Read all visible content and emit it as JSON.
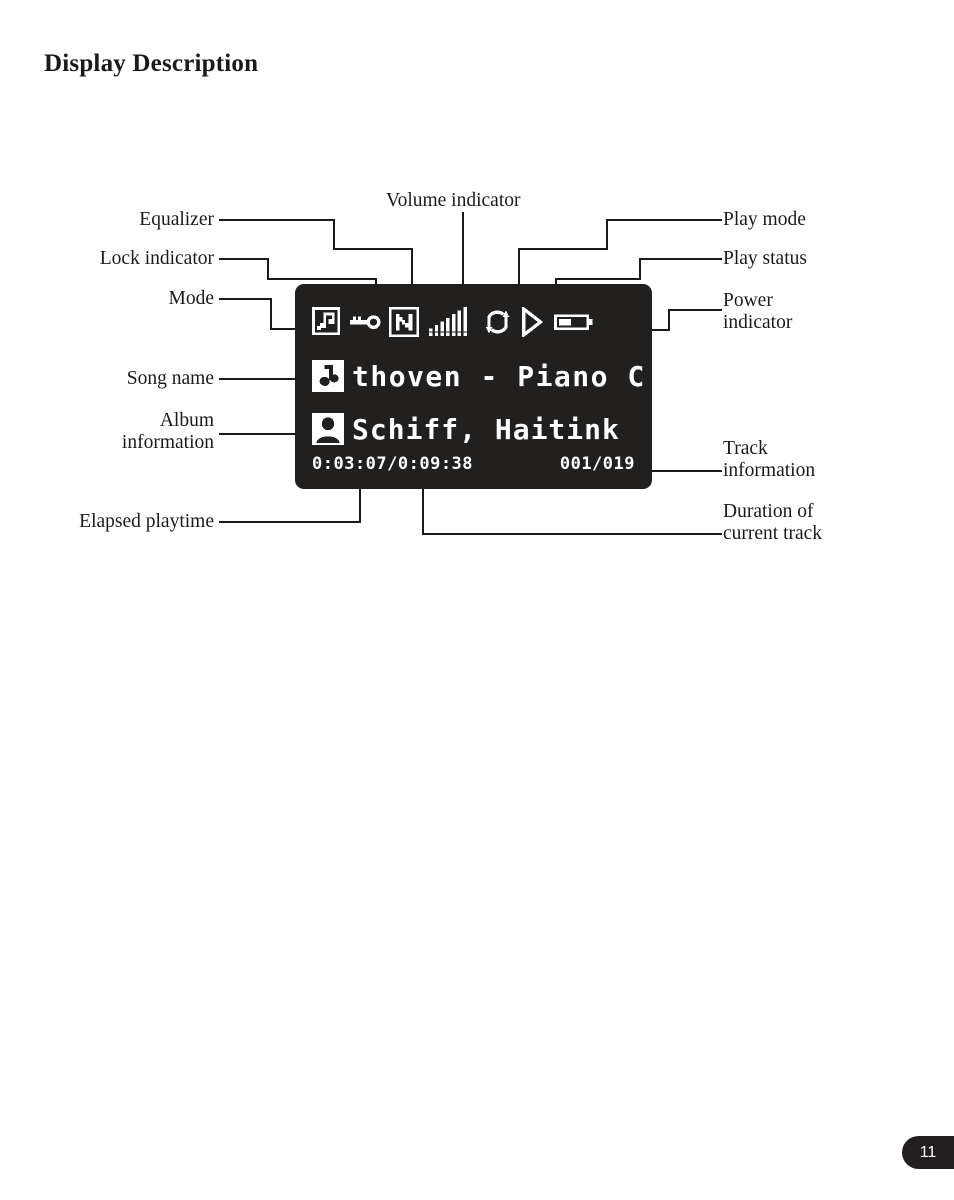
{
  "page": {
    "title": "Display Description",
    "page_number": "11",
    "background_color": "#ffffff",
    "ink_color": "#1a1a1a"
  },
  "callouts": {
    "equalizer": "Equalizer",
    "lock_indicator": "Lock indicator",
    "mode": "Mode",
    "volume_indicator": "Volume indicator",
    "song_name": "Song name",
    "album_information": "Album\ninformation",
    "elapsed_playtime": "Elapsed playtime",
    "play_mode": "Play mode",
    "play_status": "Play status",
    "power_indicator": "Power\nindicator",
    "track_information": "Track\ninformation",
    "duration_of_current_track": "Duration of\ncurrent track"
  },
  "lcd": {
    "screen_color": "#221f1f",
    "pixel_color": "#ffffff",
    "status_bar": {
      "equalizer_icon": "music-note-equalizer-icon",
      "lock_icon": "key-lock-icon",
      "mode_icon": "boxed-letter-n-icon",
      "mode_letter": "N",
      "volume_icon": "volume-bars-icon",
      "volume_bars_total": 7,
      "volume_bars_filled": 7,
      "play_mode_icon": "repeat-all-icon",
      "play_status_icon": "play-triangle-icon",
      "power_icon": "battery-icon",
      "battery_level_fraction": 0.45
    },
    "song_row": {
      "icon": "music-note-icon",
      "text": "thoven - Piano C"
    },
    "album_row": {
      "icon": "person-artist-icon",
      "text": "Schiff, Haitink"
    },
    "time_row": {
      "elapsed_and_duration": "0:03:07/0:09:38",
      "elapsed": "0:03:07",
      "duration": "0:09:38",
      "track_information": "001/019",
      "current_track": "001",
      "total_tracks": "019"
    }
  }
}
